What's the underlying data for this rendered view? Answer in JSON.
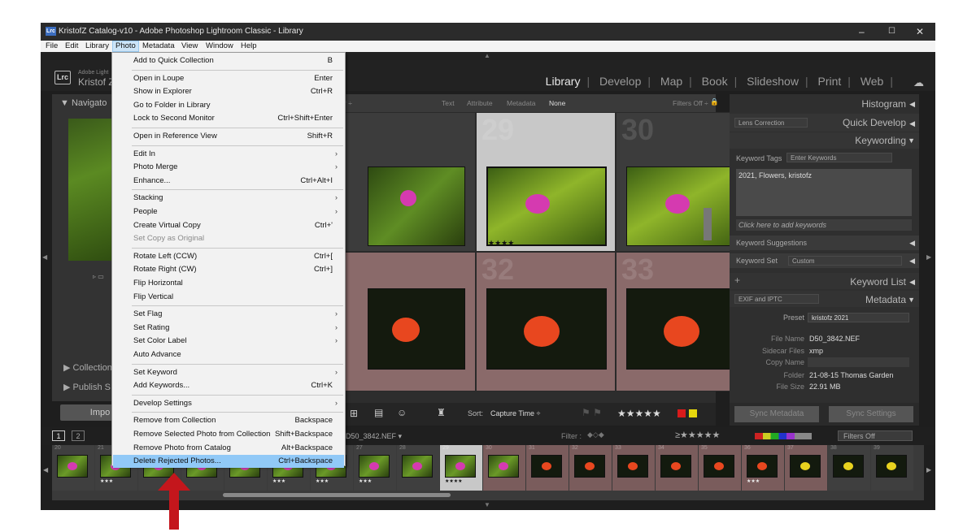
{
  "window": {
    "title": "KristofZ Catalog-v10 - Adobe Photoshop Lightroom Classic - Library",
    "app_icon": "Lrc",
    "controls": [
      "–",
      "☐",
      "✕"
    ]
  },
  "menubar": [
    "File",
    "Edit",
    "Library",
    "Photo",
    "Metadata",
    "View",
    "Window",
    "Help"
  ],
  "identity": {
    "logo": "Lrc",
    "adobe": "Adobe Light",
    "user": "Kristof Z"
  },
  "modules": [
    "Library",
    "Develop",
    "Map",
    "Book",
    "Slideshow",
    "Print",
    "Web"
  ],
  "active_module": "Library",
  "left_panel": {
    "navigator": "▼ Navigato",
    "collections": "▶ Collection",
    "publish": "▶ Publish S",
    "import": "Impo"
  },
  "filter_bar": {
    "items": [
      "Text",
      "Attribute",
      "Metadata",
      "None"
    ],
    "filters": "Filters Off ÷"
  },
  "grid": {
    "cells": [
      {
        "num": "29",
        "stars": "★★★★"
      },
      {
        "num": "30",
        "stars": ""
      },
      {
        "num": "32",
        "stars": ""
      },
      {
        "num": "33",
        "stars": ""
      }
    ]
  },
  "toolbar": {
    "sort_label": "Sort:",
    "sort_value": "Capture Time ÷",
    "rating": "★★★★★"
  },
  "right_panel": {
    "histogram": "Histogram",
    "quick_develop_preset": "Lens Correction",
    "quick_develop": "Quick Develop",
    "keywording": "Keywording",
    "keyword_tags_label": "Keyword Tags",
    "keyword_tags_value": "Enter Keywords",
    "keywords": "2021, Flowers, kristofz",
    "add_keywords": "Click here to add keywords",
    "keyword_suggestions": "Keyword Suggestions",
    "keyword_set_label": "Keyword Set",
    "keyword_set_value": "Custom",
    "keyword_list": "Keyword List",
    "metadata_preset_select": "EXIF and IPTC",
    "metadata": "Metadata",
    "preset_label": "Preset",
    "preset_value": "kristofz 2021",
    "file_name_label": "File Name",
    "file_name_value": "D50_3842.NEF",
    "sidecar_label": "Sidecar Files",
    "sidecar_value": "xmp",
    "copy_name_label": "Copy Name",
    "folder_label": "Folder",
    "folder_value": "21-08-15 Thomas Garden",
    "filesize_label": "File Size",
    "filesize_value": "22.91 MB",
    "sync_metadata": "Sync Metadata",
    "sync_settings": "Sync Settings"
  },
  "filmstrip_bar": {
    "pages": [
      "1",
      "2"
    ],
    "filename": "D50_3842.NEF ▾",
    "filter_label": "Filter :",
    "filters_off": "Filters Off"
  },
  "filmstrip": {
    "frames": [
      {
        "num": "20",
        "stars": ""
      },
      {
        "num": "21",
        "stars": "★★★"
      },
      {
        "num": "22",
        "stars": ""
      },
      {
        "num": "23",
        "stars": ""
      },
      {
        "num": "24",
        "stars": ""
      },
      {
        "num": "25",
        "stars": "★★★"
      },
      {
        "num": "26",
        "stars": "★★★"
      },
      {
        "num": "27",
        "stars": "★★★"
      },
      {
        "num": "28",
        "stars": ""
      },
      {
        "num": "29",
        "stars": "★★★★"
      },
      {
        "num": "30",
        "stars": ""
      },
      {
        "num": "31",
        "stars": ""
      },
      {
        "num": "32",
        "stars": ""
      },
      {
        "num": "33",
        "stars": ""
      },
      {
        "num": "34",
        "stars": ""
      },
      {
        "num": "35",
        "stars": ""
      },
      {
        "num": "36",
        "stars": "★★★"
      },
      {
        "num": "37",
        "stars": ""
      },
      {
        "num": "38",
        "stars": ""
      },
      {
        "num": "39",
        "stars": ""
      }
    ]
  },
  "photo_menu": {
    "items": [
      {
        "label": "Add to Quick Collection",
        "shortcut": "B"
      },
      {
        "sep": true
      },
      {
        "label": "Open in Loupe",
        "shortcut": "Enter"
      },
      {
        "label": "Show in Explorer",
        "shortcut": "Ctrl+R"
      },
      {
        "label": "Go to Folder in Library",
        "shortcut": ""
      },
      {
        "label": "Lock to Second Monitor",
        "shortcut": "Ctrl+Shift+Enter"
      },
      {
        "sep": true
      },
      {
        "label": "Open in Reference View",
        "shortcut": "Shift+R"
      },
      {
        "sep": true
      },
      {
        "label": "Edit In",
        "submenu": true
      },
      {
        "label": "Photo Merge",
        "submenu": true
      },
      {
        "label": "Enhance...",
        "shortcut": "Ctrl+Alt+I"
      },
      {
        "sep": true
      },
      {
        "label": "Stacking",
        "submenu": true
      },
      {
        "label": "People",
        "submenu": true
      },
      {
        "label": "Create Virtual Copy",
        "shortcut": "Ctrl+'"
      },
      {
        "label": "Set Copy as Original",
        "shortcut": "",
        "disabled": true
      },
      {
        "sep": true
      },
      {
        "label": "Rotate Left (CCW)",
        "shortcut": "Ctrl+["
      },
      {
        "label": "Rotate Right (CW)",
        "shortcut": "Ctrl+]"
      },
      {
        "label": "Flip Horizontal",
        "shortcut": ""
      },
      {
        "label": "Flip Vertical",
        "shortcut": ""
      },
      {
        "sep": true
      },
      {
        "label": "Set Flag",
        "submenu": true
      },
      {
        "label": "Set Rating",
        "submenu": true
      },
      {
        "label": "Set Color Label",
        "submenu": true
      },
      {
        "label": "Auto Advance",
        "shortcut": ""
      },
      {
        "sep": true
      },
      {
        "label": "Set Keyword",
        "submenu": true
      },
      {
        "label": "Add Keywords...",
        "shortcut": "Ctrl+K"
      },
      {
        "sep": true
      },
      {
        "label": "Develop Settings",
        "submenu": true
      },
      {
        "sep": true
      },
      {
        "label": "Remove from Collection",
        "shortcut": "Backspace"
      },
      {
        "label": "Remove Selected Photo from Collection",
        "shortcut": "Shift+Backspace"
      },
      {
        "label": "Remove Photo from Catalog",
        "shortcut": "Alt+Backspace"
      },
      {
        "label": "Delete Rejected Photos...",
        "shortcut": "Ctrl+Backspace",
        "highlighted": true
      }
    ]
  },
  "colors": {
    "highlight": "#91c9f7",
    "annotation_arrow": "#c4161c",
    "selected_cell": "#c8c8c8",
    "rejected_cell": "#8a6a6a"
  }
}
